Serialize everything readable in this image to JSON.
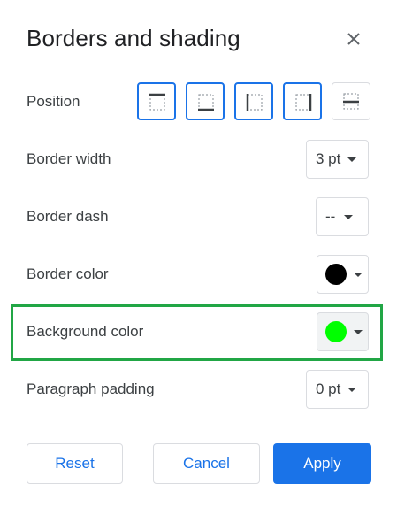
{
  "dialog": {
    "title": "Borders and shading"
  },
  "position": {
    "label": "Position"
  },
  "border_width": {
    "label": "Border width",
    "value": "3 pt"
  },
  "border_dash": {
    "label": "Border dash",
    "value": "--"
  },
  "border_color": {
    "label": "Border color",
    "swatch": "#000000"
  },
  "background_color": {
    "label": "Background color",
    "swatch": "#00ff00"
  },
  "paragraph_padding": {
    "label": "Paragraph padding",
    "value": "0 pt"
  },
  "actions": {
    "reset": "Reset",
    "cancel": "Cancel",
    "apply": "Apply"
  },
  "colors": {
    "accent": "#1a73e8",
    "highlight": "#21a645"
  }
}
